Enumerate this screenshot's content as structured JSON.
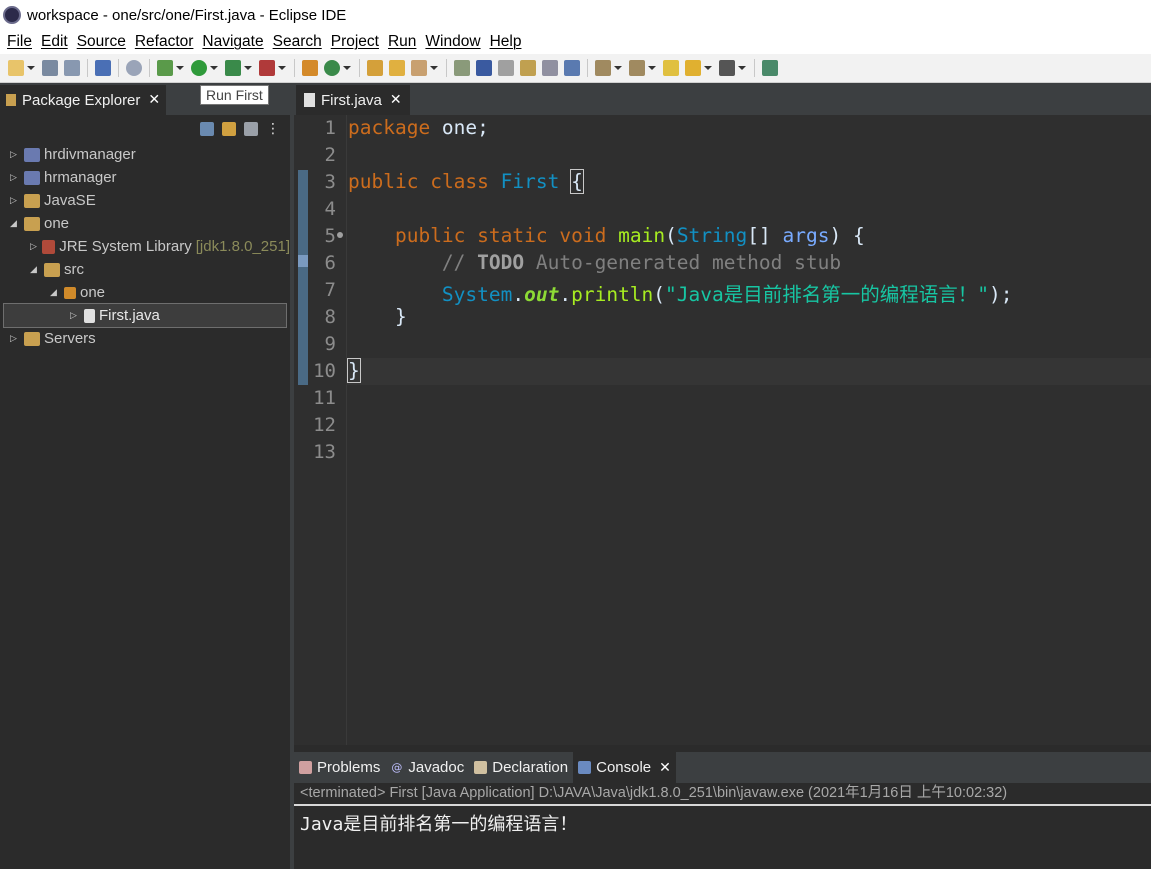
{
  "window": {
    "title": "workspace - one/src/one/First.java - Eclipse IDE"
  },
  "menu": [
    "File",
    "Edit",
    "Source",
    "Refactor",
    "Navigate",
    "Search",
    "Project",
    "Run",
    "Window",
    "Help"
  ],
  "package_explorer": {
    "tab_label": "Package Explorer",
    "tooltip": "Run First",
    "tree": [
      {
        "label": "hrdivmanager",
        "extra": ""
      },
      {
        "label": "hrmanager",
        "extra": ""
      },
      {
        "label": "JavaSE",
        "extra": ""
      },
      {
        "label": "one",
        "extra": ""
      },
      {
        "label": "JRE System Library",
        "extra": "[jdk1.8.0_251]"
      },
      {
        "label": "src",
        "extra": ""
      },
      {
        "label": "one",
        "extra": ""
      },
      {
        "label": "First.java",
        "extra": ""
      },
      {
        "label": "Servers",
        "extra": ""
      }
    ]
  },
  "editor": {
    "tab_label": "First.java",
    "line_numbers": [
      "1",
      "2",
      "3",
      "4",
      "5",
      "6",
      "7",
      "8",
      "9",
      "10",
      "11",
      "12",
      "13"
    ],
    "tokens": {
      "package": "package",
      "pkg_name": " one;",
      "public": "public",
      "class": "class",
      "class_name": "First",
      "brace_open": "{",
      "static": "static",
      "void": "void",
      "main": "main",
      "lparen": "(",
      "string": "String",
      "arr": "[] ",
      "args": "args",
      "rparen_brace": ") {",
      "comment_start": "// ",
      "todo": "TODO",
      "comment_rest": " Auto-generated method stub",
      "system": "System",
      "dot1": ".",
      "out": "out",
      "dot2": ".",
      "println": "println",
      "paren_open": "(",
      "string_literal": "\"Java是目前排名第一的编程语言！\"",
      "paren_close": ");",
      "brace_close_inner": "}",
      "brace_close_outer": "}"
    }
  },
  "bottom_panel": {
    "tabs": [
      "Problems",
      "Javadoc",
      "Declaration",
      "Console"
    ],
    "active_tab": "Console",
    "console_header": "<terminated> First [Java Application] D:\\JAVA\\Java\\jdk1.8.0_251\\bin\\javaw.exe (2021年1月16日 上午10:02:32)",
    "console_output": "Java是目前排名第一的编程语言！"
  }
}
